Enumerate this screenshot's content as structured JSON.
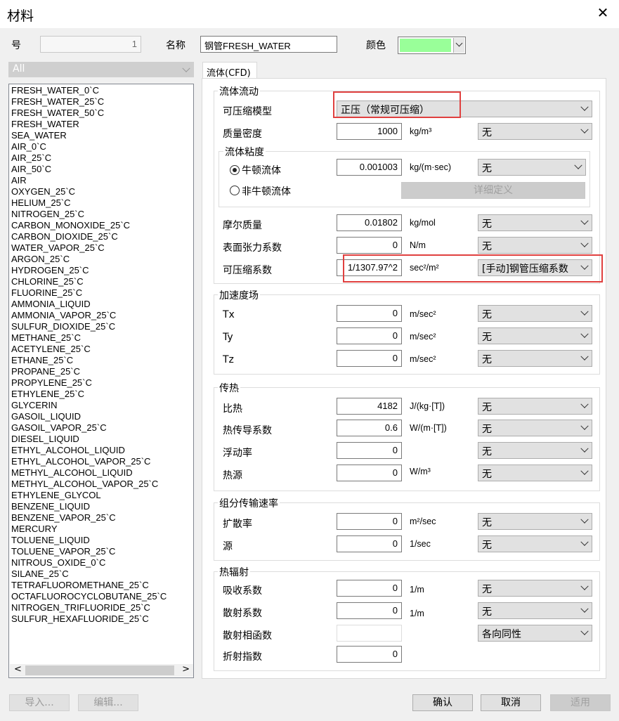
{
  "window": {
    "title": "材料",
    "close_glyph": "✕"
  },
  "header": {
    "number_label": "号",
    "number_value": "1",
    "name_label": "名称",
    "name_value": "钢管FRESH_WATER",
    "color_label": "颜色",
    "color_swatch": "#99ff99"
  },
  "filter": {
    "value": "All"
  },
  "materials": [
    "FRESH_WATER_0`C",
    "FRESH_WATER_25`C",
    "FRESH_WATER_50`C",
    "FRESH_WATER",
    "SEA_WATER",
    "AIR_0`C",
    "AIR_25`C",
    "AIR_50`C",
    "AIR",
    "OXYGEN_25`C",
    "HELIUM_25`C",
    "NITROGEN_25`C",
    "CARBON_MONOXIDE_25`C",
    "CARBON_DIOXIDE_25`C",
    "WATER_VAPOR_25`C",
    "ARGON_25`C",
    "HYDROGEN_25`C",
    "CHLORINE_25`C",
    "FLUORINE_25`C",
    "AMMONIA_LIQUID",
    "AMMONIA_VAPOR_25`C",
    "SULFUR_DIOXIDE_25`C",
    "METHANE_25`C",
    "ACETYLENE_25`C",
    "ETHANE_25`C",
    "PROPANE_25`C",
    "PROPYLENE_25`C",
    "ETHYLENE_25`C",
    "GLYCERIN",
    "GASOIL_LIQUID",
    "GASOIL_VAPOR_25`C",
    "DIESEL_LIQUID",
    "ETHYL_ALCOHOL_LIQUID",
    "ETHYL_ALCOHOL_VAPOR_25`C",
    "METHYL_ALCOHOL_LIQUID",
    "METHYL_ALCOHOL_VAPOR_25`C",
    "ETHYLENE_GLYCOL",
    "BENZENE_LIQUID",
    "BENZENE_VAPOR_25`C",
    "MERCURY",
    "TOLUENE_LIQUID",
    "TOLUENE_VAPOR_25`C",
    "NITROUS_OXIDE_0`C",
    "SILANE_25`C",
    "TETRAFLUOROMETHANE_25`C",
    "OCTAFLUOROCYCLOBUTANE_25`C",
    "NITROGEN_TRIFLUORIDE_25`C",
    "SULFUR_HEXAFLUORIDE_25`C"
  ],
  "scroll": {
    "left": "<",
    "right": ">"
  },
  "tab": {
    "label": "流体(CFD)"
  },
  "fluid_flow": {
    "title": "流体流动",
    "compress_model_label": "可压缩模型",
    "compress_model_value": "正压（常规可压缩）",
    "density_label": "质量密度",
    "density_value": "1000",
    "density_unit": "kg/m³",
    "density_source": "无",
    "viscosity": {
      "title": "流体粘度",
      "newtonian_label": "牛顿流体",
      "newtonian_value": "0.001003",
      "newtonian_unit": "kg/(m·sec)",
      "newtonian_source": "无",
      "non_newtonian_label": "非牛顿流体",
      "detail_button": "详细定义"
    },
    "molar_label": "摩尔质量",
    "molar_value": "0.01802",
    "molar_unit": "kg/mol",
    "molar_source": "无",
    "surface_label": "表面张力系数",
    "surface_value": "0",
    "surface_unit": "N/m",
    "surface_source": "无",
    "compress_coef_label": "可压缩系数",
    "compress_coef_value": "1/1307.97^2",
    "compress_coef_unit": "sec²/m²",
    "compress_coef_source": "[手动]钢管压缩系数"
  },
  "gravity": {
    "title": "加速度场",
    "tx_label": "Tx",
    "tx_value": "0",
    "tx_unit": "m/sec²",
    "tx_source": "无",
    "ty_label": "Ty",
    "ty_value": "0",
    "ty_unit": "m/sec²",
    "ty_source": "无",
    "tz_label": "Tz",
    "tz_value": "0",
    "tz_unit": "m/sec²",
    "tz_source": "无"
  },
  "heat": {
    "title": "传热",
    "cp_label": "比热",
    "cp_value": "4182",
    "cp_unit": "J/(kg·[T])",
    "cp_source": "无",
    "k_label": "热传导系数",
    "k_value": "0.6",
    "k_unit": "W/(m·[T])",
    "k_source": "无",
    "buoy_label": "浮动率",
    "buoy_value": "0",
    "buoy_source": "无",
    "src_label": "热源",
    "src_value": "0",
    "src_unit": "W/m³",
    "src_source": "无"
  },
  "species": {
    "title": "组分传输速率",
    "diff_label": "扩散率",
    "diff_value": "0",
    "diff_unit": "m²/sec",
    "diff_source": "无",
    "src_label": "源",
    "src_value": "0",
    "src_unit": "1/sec",
    "src_source": "无"
  },
  "radiation": {
    "title": "热辐射",
    "abs_label": "吸收系数",
    "abs_value": "0",
    "abs_unit": "1/m",
    "abs_source": "无",
    "scat_label": "散射系数",
    "scat_value": "0",
    "scat_unit": "1/m",
    "scat_source": "无",
    "phase_label": "散射相函数",
    "phase_source": "各向同性",
    "refr_label": "折射指数",
    "refr_value": "0"
  },
  "footer": {
    "import_label": "导入...",
    "edit_label": "编辑...",
    "ok_label": "确认",
    "cancel_label": "取消",
    "apply_label": "适用"
  }
}
